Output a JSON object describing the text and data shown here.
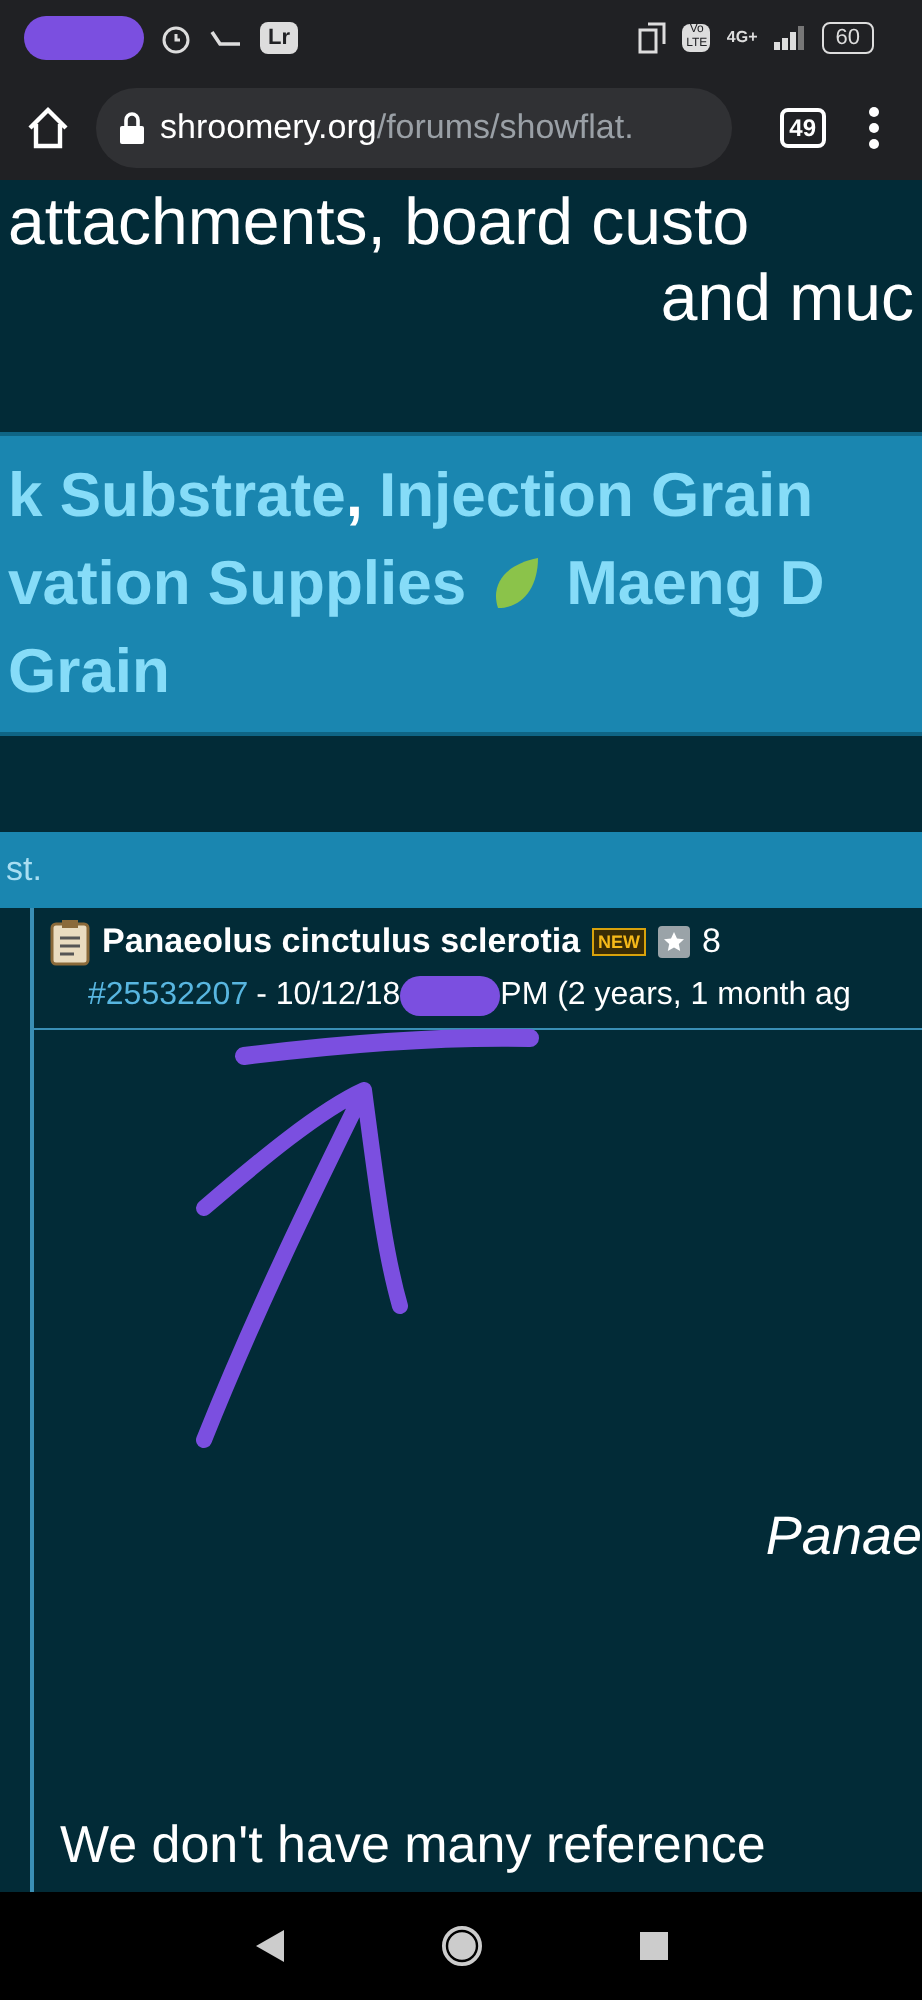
{
  "status_bar": {
    "app_badge": "Lr",
    "volte": "Vo LTE",
    "network": "4G+",
    "battery": "60"
  },
  "browser": {
    "url_host": "shroomery.org",
    "url_path": "/forums/showflat.",
    "tab_count": "49"
  },
  "intro_lines": [
    "attachments, board custo",
    "and muc"
  ],
  "banner_lines": [
    {
      "links": [
        "k Substrate",
        "Injection Grain"
      ],
      "separator": ",",
      "leaf_icon": false
    },
    {
      "links": [
        "vation Supplies",
        "Maeng D"
      ],
      "leaf_icon": true
    },
    {
      "links": [
        "Grain"
      ],
      "leaf_icon": false
    }
  ],
  "notice": "st.",
  "post": {
    "title": "Panaeolus cinctulus sclerotia",
    "new_badge": "NEW",
    "rating": "8",
    "post_id": "#25532207",
    "date": "- 10/12/18",
    "time_rest": "PM (2 years, 1 month ag"
  },
  "body": {
    "italic_line": "Panae",
    "paragraph": "We don't have many reference"
  }
}
